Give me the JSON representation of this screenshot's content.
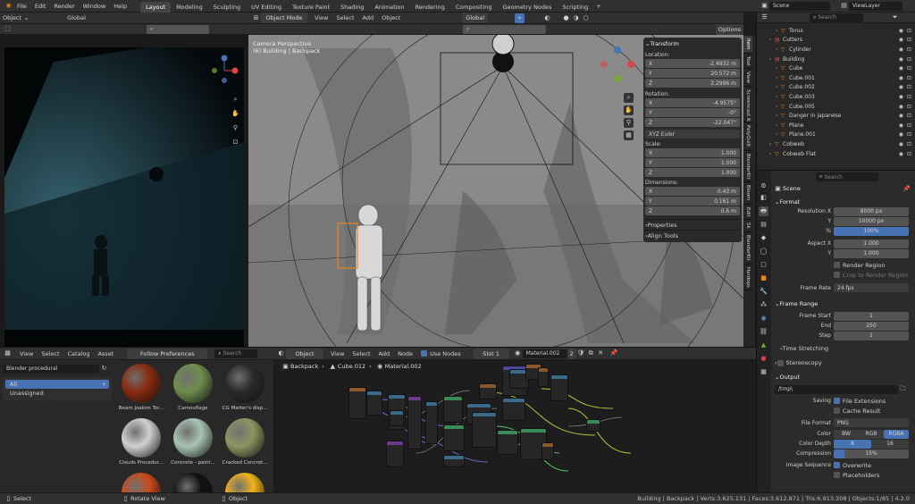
{
  "topbar": {
    "menus": [
      "File",
      "Edit",
      "Render",
      "Window",
      "Help"
    ],
    "tabs": [
      "Layout",
      "Modeling",
      "Sculpting",
      "UV Editing",
      "Texture Paint",
      "Shading",
      "Animation",
      "Rendering",
      "Compositing",
      "Geometry Nodes",
      "Scripting"
    ],
    "active_tab": "Layout",
    "scene": "Scene",
    "view_layer": "ViewLayer"
  },
  "camera_view": {
    "mode": "Object",
    "orientation": "Global"
  },
  "viewport": {
    "mode": "Object Mode",
    "menus": [
      "View",
      "Select",
      "Add",
      "Object"
    ],
    "orientation": "Global",
    "camera_label": "Camera Perspective",
    "context_label": "(6) Building | Backpack",
    "options": "Options"
  },
  "npanel": {
    "tabs": [
      "Item",
      "Tool",
      "View",
      "Screencast Keys",
      "PolyQuilt",
      "BlenderKit",
      "Bloom",
      "Edit",
      "Sk",
      "BlenderKit",
      "Hardops"
    ],
    "transform_title": "Transform",
    "location_label": "Location:",
    "location": {
      "x": "-2.4932 m",
      "y": "20.572 m",
      "z": "2.2996 m"
    },
    "rotation_label": "Rotation:",
    "rotation": {
      "x": "-4.9575°",
      "y": "-0°",
      "z": "-22.047°"
    },
    "rotation_mode": "XYZ Euler",
    "scale_label": "Scale:",
    "scale": {
      "x": "1.000",
      "y": "1.000",
      "z": "1.000"
    },
    "dimensions_label": "Dimensions:",
    "dimensions": {
      "x": "0.43 m",
      "y": "0.161 m",
      "z": "0.6 m"
    },
    "properties": "Properties",
    "align_tools": "Align Tools",
    "axis": {
      "x": "X",
      "y": "Y",
      "z": "Z"
    }
  },
  "outliner": {
    "search": "Search",
    "items": [
      {
        "label": "Torus",
        "indent": 3
      },
      {
        "label": "Cutters",
        "indent": 2
      },
      {
        "label": "Cylinder",
        "indent": 3
      },
      {
        "label": "Building",
        "indent": 2
      },
      {
        "label": "Cube",
        "indent": 3
      },
      {
        "label": "Cube.001",
        "indent": 3
      },
      {
        "label": "Cube.002",
        "indent": 3
      },
      {
        "label": "Cube.003",
        "indent": 3
      },
      {
        "label": "Cube.005",
        "indent": 3
      },
      {
        "label": "Danger in japanese",
        "indent": 3
      },
      {
        "label": "Plane",
        "indent": 3
      },
      {
        "label": "Plane.001",
        "indent": 3
      },
      {
        "label": "Cobweb",
        "indent": 2
      },
      {
        "label": "Cobweb Flat",
        "indent": 2
      }
    ]
  },
  "properties": {
    "search": "Search",
    "context": "Scene",
    "format": {
      "title": "Format",
      "res_x_label": "Resolution X",
      "res_x": "8000 px",
      "y_label": "Y",
      "res_y": "10000 px",
      "pct_label": "%",
      "pct": "100%",
      "aspect_x_label": "Aspect X",
      "aspect_x": "1.000",
      "aspect_y_label": "Y",
      "aspect_y": "1.000",
      "render_region": "Render Region",
      "crop": "Crop to Render Region",
      "frame_rate_label": "Frame Rate",
      "frame_rate": "24 fps"
    },
    "frame_range": {
      "title": "Frame Range",
      "start_label": "Frame Start",
      "start": "1",
      "end_label": "End",
      "end": "250",
      "step_label": "Step",
      "step": "1"
    },
    "time_stretching": "Time Stretching",
    "stereoscopy": "Stereoscopy",
    "output": {
      "title": "Output",
      "path": "/tmp\\",
      "saving_label": "Saving",
      "file_ext": "File Extensions",
      "cache_result": "Cache Result",
      "file_format_label": "File Format",
      "file_format": "PNG",
      "color_label": "Color",
      "color_opts": [
        "BW",
        "RGB",
        "RGBA"
      ],
      "color_depth_label": "Color Depth",
      "depth_opts": [
        "8",
        "16"
      ],
      "compression_label": "Compression",
      "compression": "15%",
      "image_seq_label": "Image Sequence",
      "overwrite": "Overwrite",
      "placeholders": "Placeholders"
    }
  },
  "asset_browser": {
    "menus": [
      "View",
      "Select",
      "Catalog",
      "Asset"
    ],
    "import": "Follow Preferences",
    "search": "Search",
    "library": "Blender procedural",
    "catalogs": [
      "All",
      "Unassigned"
    ],
    "assets": [
      "Beam Joakim Tor...",
      "Camouflage",
      "CG Matter's disp...",
      "Clouds Procedur...",
      "Concrete - paint...",
      "Cracked Concret..."
    ]
  },
  "node_editor": {
    "type": "Object",
    "menus": [
      "View",
      "Select",
      "Add",
      "Node"
    ],
    "use_nodes": "Use Nodes",
    "slot": "Slot 1",
    "material": "Material.002",
    "users": "2",
    "breadcrumb": [
      "Backpack",
      "Cube.012",
      "Material.002"
    ]
  },
  "statusbar": {
    "select": "Select",
    "rotate": "Rotate View",
    "object": "Object",
    "info": "Building | Backpack | Verts:3,625,131 | Faces:3,612,871 | Tris:6,913,308 | Objects:1/85 | 4.2.0"
  },
  "colors": {
    "accent": "#4772b3",
    "bg": "#1d1d1d",
    "header": "#303030"
  }
}
